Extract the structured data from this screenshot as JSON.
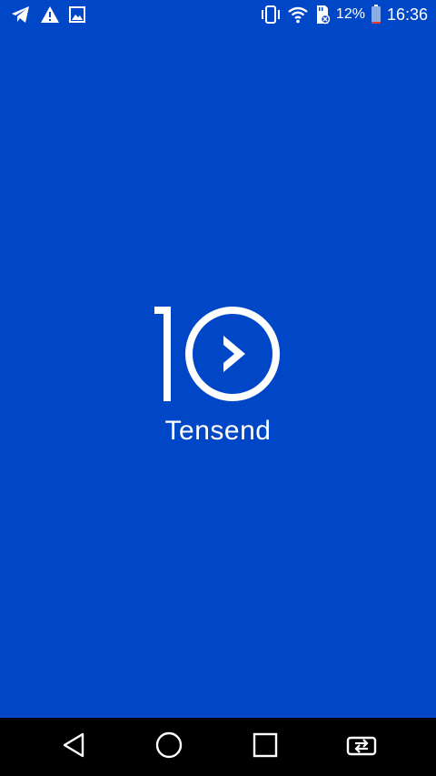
{
  "status_bar": {
    "notification_icons": [
      "telegram-icon",
      "warning-icon",
      "image-icon"
    ],
    "system_icons": [
      "vibrate-icon",
      "wifi-icon",
      "sd-card-icon"
    ],
    "battery_percent": "12%",
    "battery_level": 0.12,
    "time": "16:36"
  },
  "splash": {
    "app_name": "Tensend",
    "logo_icon": "tensend-logo-icon"
  },
  "nav_bar": {
    "buttons": [
      "back-icon",
      "home-icon",
      "recents-icon",
      "switch-app-icon"
    ]
  },
  "colors": {
    "background": "#0047c8",
    "foreground": "#ffffff",
    "nav_background": "#000000",
    "battery_low": "#e53935"
  }
}
